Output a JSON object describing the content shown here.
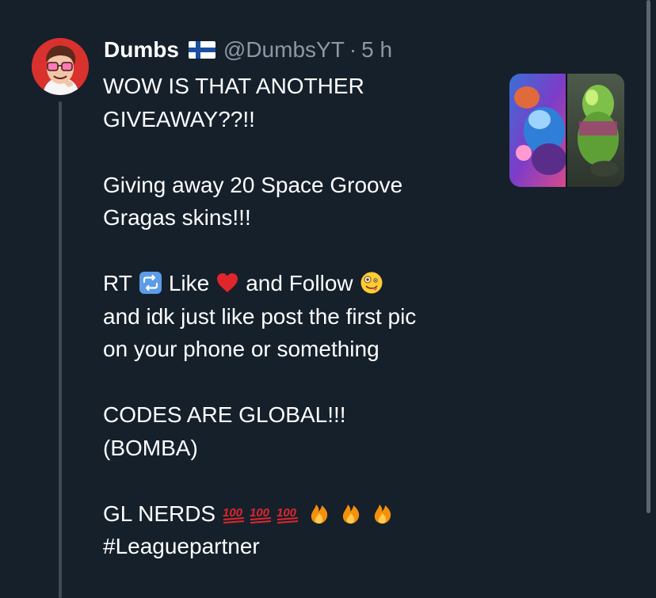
{
  "tweet": {
    "author_name": "Dumbs",
    "flag_icon": "finland-flag-icon",
    "handle": "@DumbsYT",
    "separator": "·",
    "time": "5 h",
    "lines": {
      "l1": "WOW IS THAT ANOTHER",
      "l2": "GIVEAWAY??!!",
      "l3": "Giving away 20 Space Groove",
      "l4": "Gragas skins!!!",
      "l5_rt": "RT",
      "l5_like": "Like",
      "l5_follow": "and Follow",
      "l6": "and idk just like post the first pic",
      "l7": "on your phone or something",
      "l8": "CODES ARE GLOBAL!!!",
      "l9": "(BOMBA)",
      "l10": "GL NERDS",
      "l11": "#Leaguepartner"
    },
    "emoji_names": [
      "retweet-emoji",
      "red-heart-emoji",
      "zany-face-emoji",
      "hundred-points-emoji",
      "fire-emoji"
    ]
  },
  "colors": {
    "background": "#15202b",
    "text_primary": "#ffffff",
    "text_secondary": "#8b98a5",
    "thread_line": "#3d4b57",
    "avatar_bg": "#d9312d"
  }
}
